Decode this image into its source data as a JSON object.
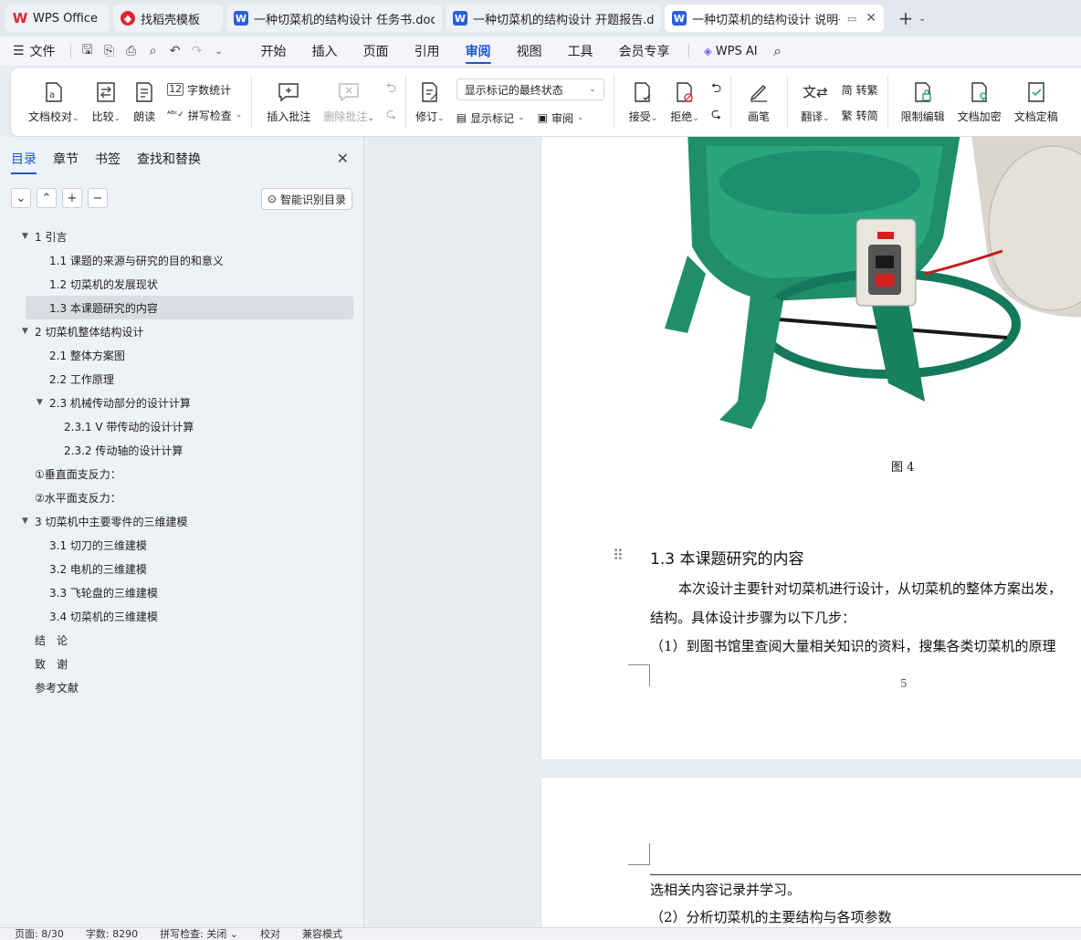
{
  "tabs": [
    {
      "label": "WPS Office",
      "icon": "wps-logo-icon",
      "color": "#e0262f",
      "glyph": "W"
    },
    {
      "label": "找稻壳模板",
      "icon": "docer-icon",
      "color": "#e0262f",
      "glyph": "◆"
    },
    {
      "label": "一种切菜机的结构设计 任务书.docx",
      "icon": "word-doc-icon",
      "color": "#2b5fde",
      "glyph": "W"
    },
    {
      "label": "一种切菜机的结构设计 开题报告.docx",
      "icon": "word-doc-icon",
      "color": "#2b5fde",
      "glyph": "W"
    },
    {
      "label": "一种切菜机的结构设计 说明书",
      "icon": "word-doc-icon",
      "color": "#2b5fde",
      "glyph": "W"
    }
  ],
  "menu": {
    "file": "文件",
    "tabs": [
      "开始",
      "插入",
      "页面",
      "引用",
      "审阅",
      "视图",
      "工具",
      "会员专享"
    ],
    "active": "审阅",
    "ai": "WPS AI"
  },
  "ribbon": {
    "doc_check": "文档校对",
    "compare": "比较",
    "read_aloud": "朗读",
    "word_count": "字数统计",
    "spell_check": "拼写检查",
    "insert_comment": "插入批注",
    "delete_comment": "删除批注",
    "track_changes": "修订",
    "markup_select": "显示标记的最终状态",
    "show_markup": "显示标记",
    "review_pane": "审阅",
    "accept": "接受",
    "reject": "拒绝",
    "pen": "画笔",
    "translate": "翻译",
    "to_traditional": "转繁",
    "to_simplified": "转简",
    "restrict_edit": "限制编辑",
    "encrypt": "文档加密",
    "finalize": "文档定稿"
  },
  "sidebar": {
    "tabs": [
      "目录",
      "章节",
      "书签",
      "查找和替换"
    ],
    "smart_toc": "智能识别目录",
    "toc": [
      {
        "label": "1  引言",
        "level": 1,
        "arrow": "▼"
      },
      {
        "label": "1.1  课题的来源与研究的目的和意义",
        "level": 2
      },
      {
        "label": "1.2  切菜机的发展现状",
        "level": 2
      },
      {
        "label": "1.3  本课题研究的内容",
        "level": 2,
        "selected": true
      },
      {
        "label": "2  切菜机整体结构设计",
        "level": 1,
        "arrow": "▼"
      },
      {
        "label": "2.1  整体方案图",
        "level": 2
      },
      {
        "label": "2.2  工作原理",
        "level": 2
      },
      {
        "label": "2.3  机械传动部分的设计计算",
        "level": 2,
        "arrow": "▼"
      },
      {
        "label": "2.3.1 V 带传动的设计计算",
        "level": 3
      },
      {
        "label": "2.3.2 传动轴的设计计算",
        "level": 3
      },
      {
        "label": "①垂直面支反力：",
        "level": 1
      },
      {
        "label": "②水平面支反力：",
        "level": 1
      },
      {
        "label": "3  切菜机中主要零件的三维建模",
        "level": 1,
        "arrow": "▼"
      },
      {
        "label": "3.1 切刀的三维建模",
        "level": 2
      },
      {
        "label": "3.2 电机的三维建模",
        "level": 2
      },
      {
        "label": "3.3 飞轮盘的三维建模",
        "level": 2
      },
      {
        "label": "3.4 切菜机的三维建模",
        "level": 2
      },
      {
        "label": "结　论",
        "level": 1
      },
      {
        "label": "致　谢",
        "level": 1
      },
      {
        "label": "参考文献",
        "level": 1
      }
    ]
  },
  "document": {
    "figure_caption": "图 4",
    "heading": "1.3  本课题研究的内容",
    "para1": "本次设计主要针对切菜机进行设计，从切菜机的整体方案出发，",
    "para2": "结构。具体设计步骤为以下几步：",
    "para3": "（1）到图书馆里查阅大量相关知识的资料，搜集各类切菜机的原理",
    "page_number": "5",
    "page2_line1": "选相关内容记录并学习。",
    "page2_line2": "（2）分析切菜机的主要结构与各项参数"
  },
  "status": {
    "page": "页面: 8/30",
    "words": "字数: 8290",
    "spell": "拼写检查: 关闭 ⌄",
    "proof": "校对",
    "compat": "兼容模式"
  }
}
